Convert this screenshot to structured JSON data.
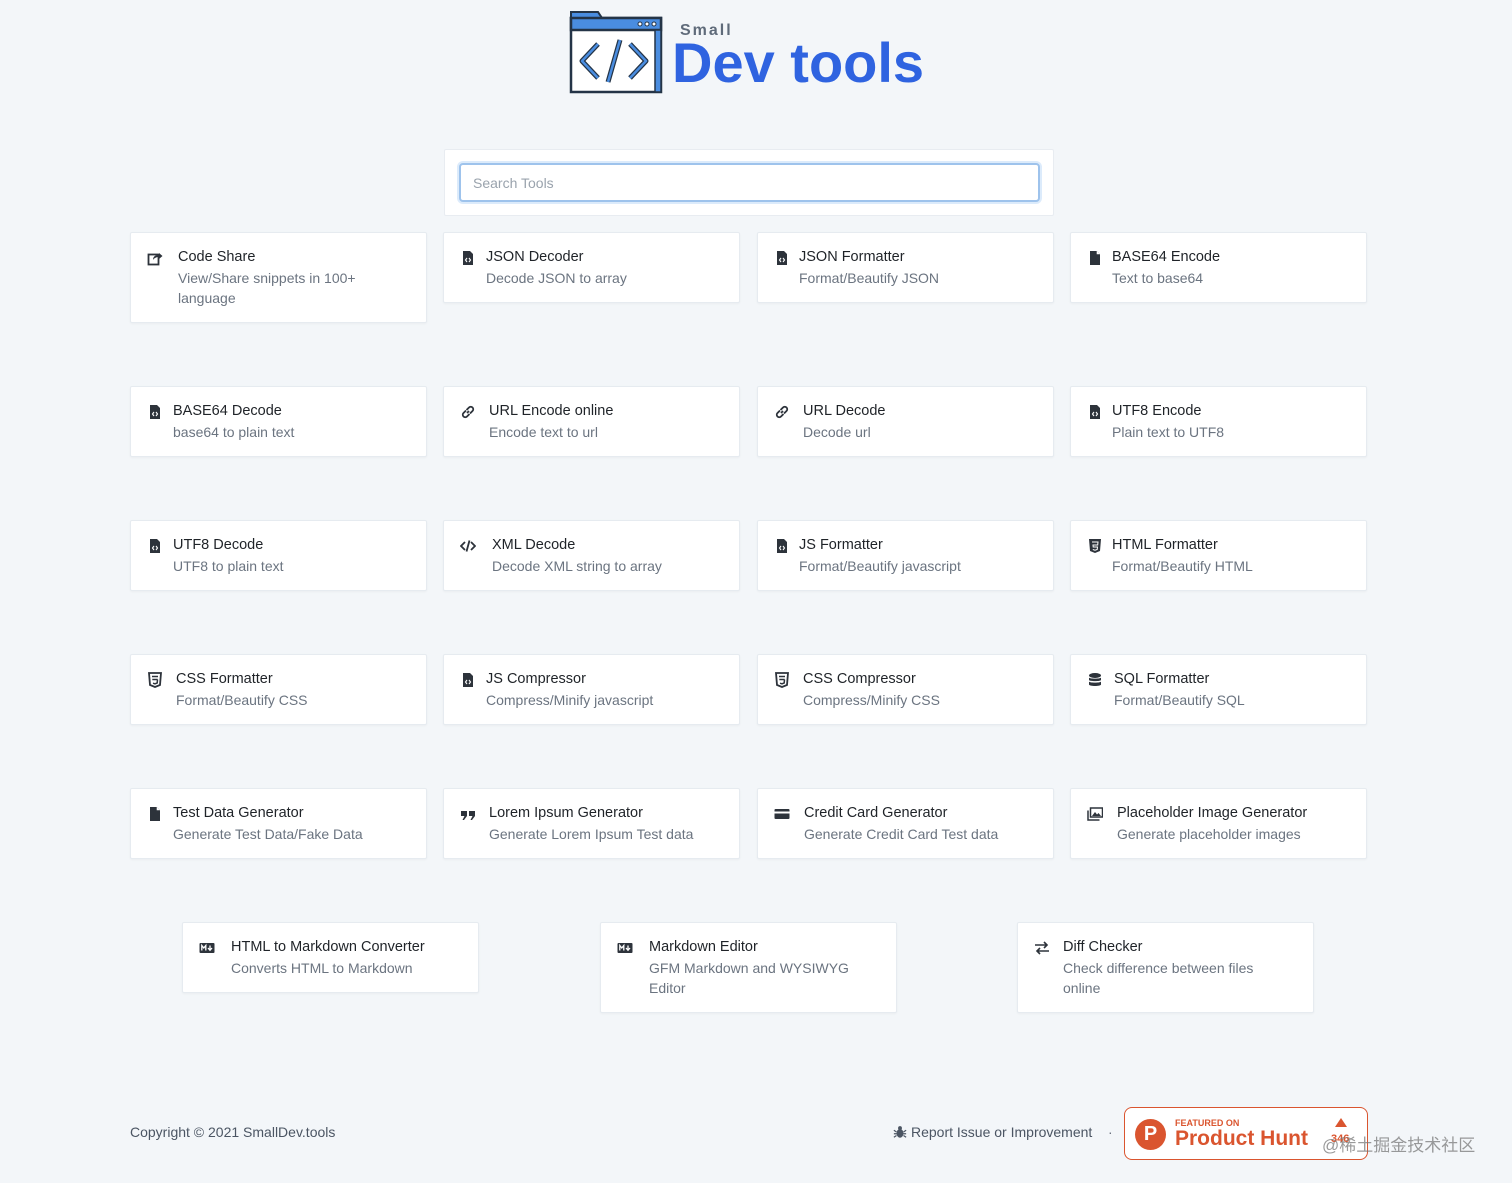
{
  "logo": {
    "small": "Small",
    "main": "Dev tools"
  },
  "search": {
    "placeholder": "Search Tools",
    "value": ""
  },
  "cards": [
    {
      "title": "Code Share",
      "desc": "View/Share snippets in 100+ language",
      "icon": "share-icon"
    },
    {
      "title": "JSON Decoder",
      "desc": "Decode JSON to array",
      "icon": "file-code-icon"
    },
    {
      "title": "JSON Formatter",
      "desc": "Format/Beautify JSON",
      "icon": "file-code-icon"
    },
    {
      "title": "BASE64 Encode",
      "desc": "Text to base64",
      "icon": "file-icon"
    },
    {
      "title": "BASE64 Decode",
      "desc": "base64 to plain text",
      "icon": "file-code-icon"
    },
    {
      "title": "URL Encode online",
      "desc": "Encode text to url",
      "icon": "link-icon"
    },
    {
      "title": "URL Decode",
      "desc": "Decode url",
      "icon": "link-icon"
    },
    {
      "title": "UTF8 Encode",
      "desc": "Plain text to UTF8",
      "icon": "file-code-icon"
    },
    {
      "title": "UTF8 Decode",
      "desc": "UTF8 to plain text",
      "icon": "file-code-icon"
    },
    {
      "title": "XML Decode",
      "desc": "Decode XML string to array",
      "icon": "code-icon"
    },
    {
      "title": "JS Formatter",
      "desc": "Format/Beautify javascript",
      "icon": "file-code-icon"
    },
    {
      "title": "HTML Formatter",
      "desc": "Format/Beautify HTML",
      "icon": "html5-icon"
    },
    {
      "title": "CSS Formatter",
      "desc": "Format/Beautify CSS",
      "icon": "css3-icon"
    },
    {
      "title": "JS Compressor",
      "desc": "Compress/Minify javascript",
      "icon": "file-code-icon"
    },
    {
      "title": "CSS Compressor",
      "desc": "Compress/Minify CSS",
      "icon": "css3-icon"
    },
    {
      "title": "SQL Formatter",
      "desc": "Format/Beautify SQL",
      "icon": "database-icon"
    },
    {
      "title": "Test Data Generator",
      "desc": "Generate Test Data/Fake Data",
      "icon": "file-icon"
    },
    {
      "title": "Lorem Ipsum Generator",
      "desc": "Generate Lorem Ipsum Test data",
      "icon": "quote-icon"
    },
    {
      "title": "Credit Card Generator",
      "desc": "Generate Credit Card Test data",
      "icon": "credit-card-icon"
    },
    {
      "title": "Placeholder Image Generator",
      "desc": "Generate placeholder images",
      "icon": "images-icon"
    },
    {
      "title": "HTML to Markdown Converter",
      "desc": "Converts HTML to Markdown",
      "icon": "markdown-icon"
    },
    {
      "title": "Markdown Editor",
      "desc": "GFM Markdown and WYSIWYG Editor",
      "icon": "markdown-icon"
    },
    {
      "title": "Diff Checker",
      "desc": "Check difference between files online",
      "icon": "exchange-icon"
    }
  ],
  "footer": {
    "copyright": "Copyright © 2021 SmallDev.tools",
    "report": "Report Issue or Improvement",
    "separator": "·",
    "product_hunt": {
      "featured": "FEATURED ON",
      "name": "Product Hunt",
      "count": "346"
    },
    "watermark": "@稀土掘金技术社区"
  }
}
